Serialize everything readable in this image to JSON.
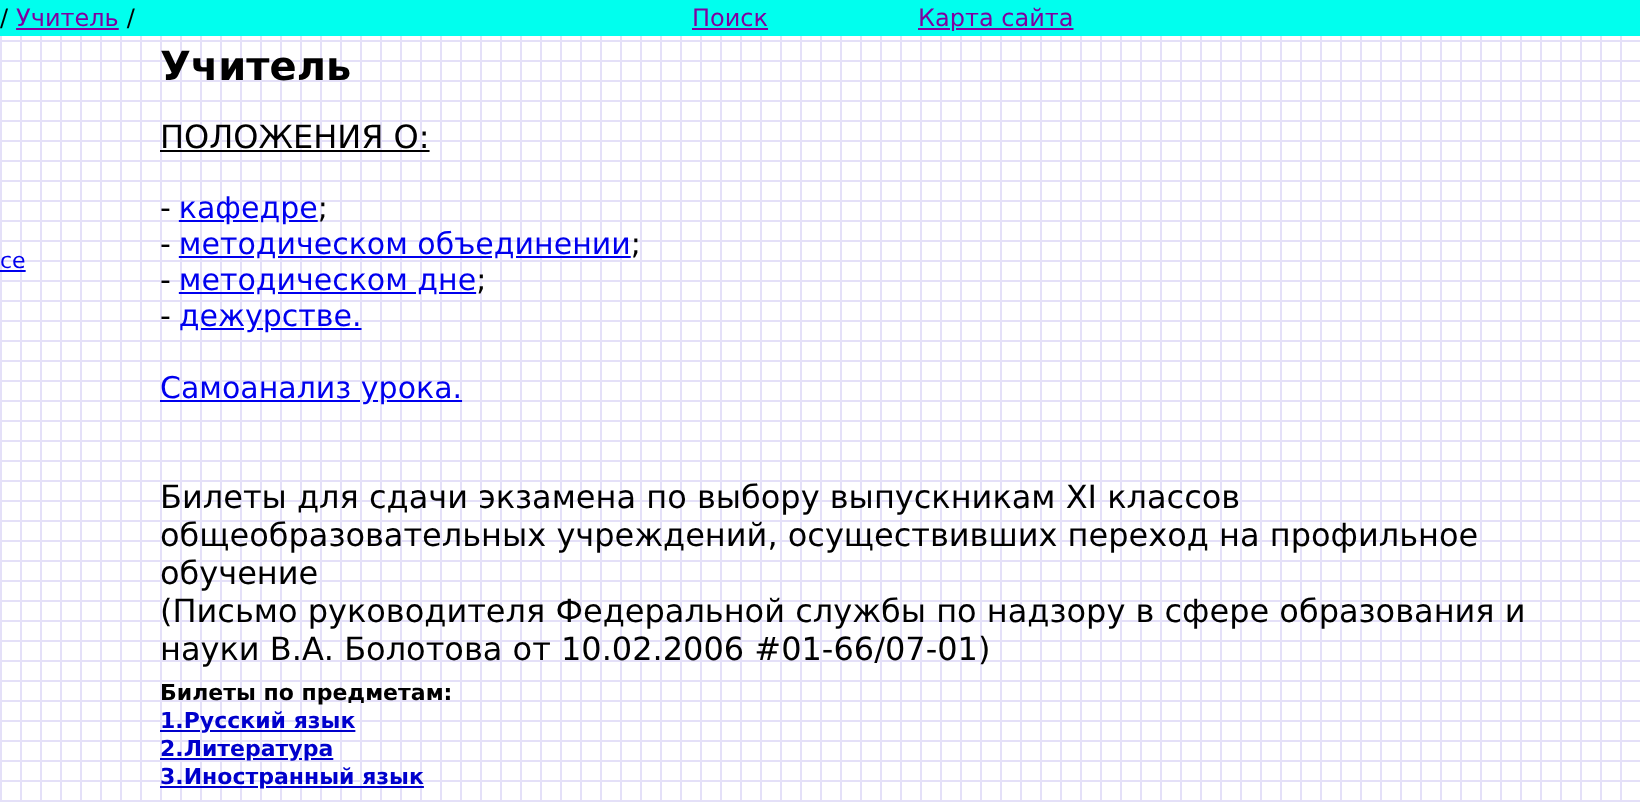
{
  "top_bar": {
    "breadcrumb": {
      "separator_before": "/",
      "link": "Учитель",
      "separator_after": "/"
    },
    "links": [
      "Поиск",
      "Карта сайта"
    ]
  },
  "side_link": "се",
  "title": "Учитель",
  "section_heading": "ПОЛОЖЕНИЯ О:",
  "regulations": [
    {
      "prefix": "-",
      "link": "кафедре",
      "suffix": ";"
    },
    {
      "prefix": "-",
      "link": "методическом объединении",
      "suffix": ";"
    },
    {
      "prefix": "-",
      "link": "методическом дне",
      "suffix": ";"
    },
    {
      "prefix": "-",
      "link": "дежурстве."
    }
  ],
  "self_analysis_link": "Самоанализ урока.",
  "tickets_text": "Билеты для сдачи экзамена по выбору выпускникам XI классов общеобразовательных учреждений, осуществивших переход на профильное обучение",
  "letter_text": "(Письмо руководителя Федеральной службы по надзору в сфере образования и науки В.А. Болотова от 10.02.2006 #01-66/07-01)",
  "subjects_heading": "Билеты по предметам:",
  "subjects": [
    "1.Русский язык",
    "2.Литература",
    "3.Иностранный язык"
  ]
}
